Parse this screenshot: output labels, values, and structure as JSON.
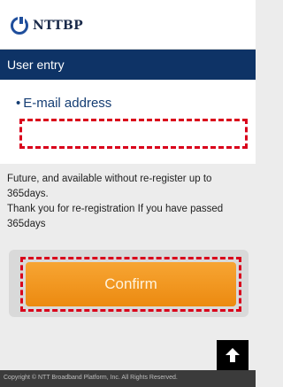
{
  "header": {
    "logo_text": "NTTBP",
    "logo_icon": "nttbp-logo-icon"
  },
  "titlebar": {
    "title": "User entry"
  },
  "form": {
    "bullet": "•",
    "email_label": "E-mail address",
    "email_value": "",
    "email_placeholder": ""
  },
  "note": {
    "line1": "Future, and available without re-register up to 365days.",
    "line2": "Thank you for re-registration If you have passed 365days"
  },
  "confirm_label": "Confirm",
  "back_to_top_icon": "arrow-up-icon",
  "footer": {
    "copyright": "Copyright © NTT Broadband Platform, Inc. All Rights Reserved."
  },
  "colors": {
    "brand_navy": "#0e3366",
    "highlight_red": "#d9001b",
    "button_orange": "#ec8a10"
  }
}
